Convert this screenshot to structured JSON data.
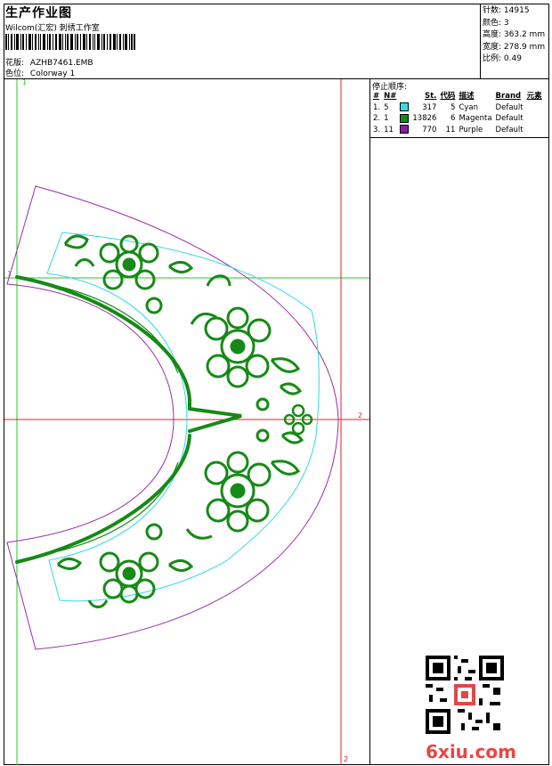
{
  "header": {
    "title": "生产作业图",
    "subtitle": "Wilcom(汇宏) 刺绣工作室",
    "pattern_label": "花版:",
    "pattern_value": "AZHB7461.EMB",
    "colorway_label": "色位:",
    "colorway_value": "Colorway 1"
  },
  "stats": [
    {
      "label": "针数:",
      "value": "14915"
    },
    {
      "label": "颜色:",
      "value": "3"
    },
    {
      "label": "高度:",
      "value": "363.2 mm"
    },
    {
      "label": "宽度:",
      "value": "278.9 mm"
    },
    {
      "label": "比例:",
      "value": "0.49"
    }
  ],
  "stop_sequence": {
    "heading": "停止顺序:",
    "columns": [
      "#",
      "N#",
      "St.",
      "代码",
      "描述",
      "Brand",
      "元素"
    ],
    "rows": [
      {
        "seq": "1.",
        "n": "5",
        "stitches": "317",
        "code": "5",
        "desc": "Cyan",
        "brand": "Default",
        "color": "#33e0e0"
      },
      {
        "seq": "2.",
        "n": "1",
        "stitches": "13826",
        "code": "6",
        "desc": "Magenta",
        "brand": "Default",
        "color": "#148a14"
      },
      {
        "seq": "3.",
        "n": "11",
        "stitches": "770",
        "code": "11",
        "desc": "Purple",
        "brand": "Default",
        "color": "#8a1aa8"
      }
    ]
  },
  "canvas": {
    "marker_1": "1",
    "marker_2": "2",
    "colors": {
      "guide_green": "#22cc22",
      "guide_red": "#e02020",
      "outline_purple": "#9a2aa8",
      "outline_cyan": "#30d8e8",
      "embroidery_green": "#168a16"
    }
  },
  "watermark": "6xiu.com"
}
